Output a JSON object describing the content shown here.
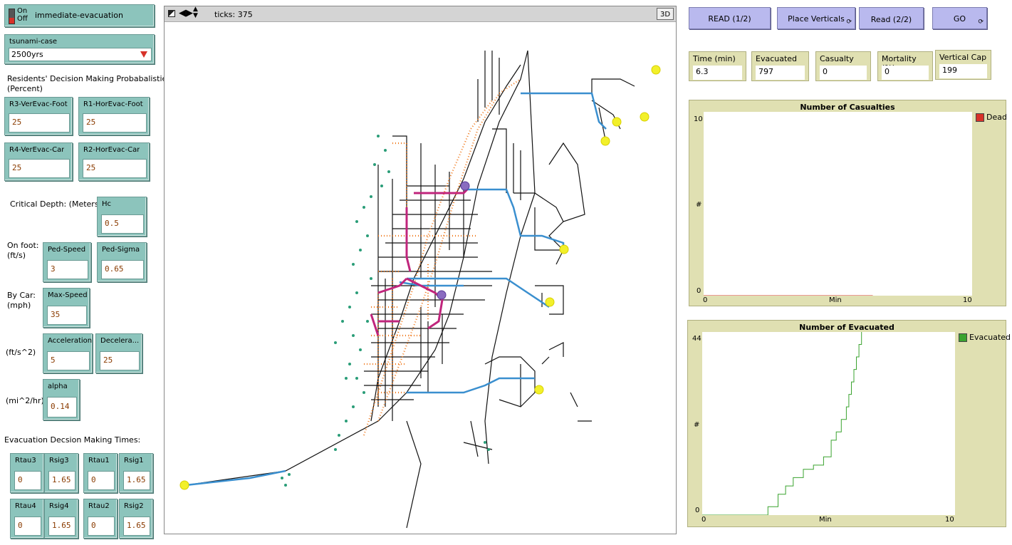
{
  "switch": {
    "on": "On",
    "off": "Off",
    "label": "immediate-evacuation"
  },
  "chooser": {
    "label": "tsunami-case",
    "value": "2500yrs"
  },
  "notes": {
    "decision_title": "Residents' Decision Making Probabalisties :",
    "decision_unit": "(Percent)",
    "critical_depth": "Critical Depth: (Meters)",
    "on_foot": "On foot:",
    "on_foot_unit": "(ft/s)",
    "by_car": "By Car:",
    "by_car_unit": "(mph)",
    "accel_unit": "(ft/s^2)",
    "alpha_unit": "(mi^2/hr)",
    "times_title": "Evacuation Decsion Making Times:"
  },
  "inputs": {
    "r3": {
      "label": "R3-VerEvac-Foot",
      "value": "25"
    },
    "r1": {
      "label": "R1-HorEvac-Foot",
      "value": "25"
    },
    "r4": {
      "label": "R4-VerEvac-Car",
      "value": "25"
    },
    "r2": {
      "label": "R2-HorEvac-Car",
      "value": "25"
    },
    "hc": {
      "label": "Hc",
      "value": "0.5"
    },
    "ped_speed": {
      "label": "Ped-Speed",
      "value": "3"
    },
    "ped_sigma": {
      "label": "Ped-Sigma",
      "value": "0.65"
    },
    "max_speed": {
      "label": "Max-Speed",
      "value": "35"
    },
    "acceleration": {
      "label": "Acceleration",
      "value": "5"
    },
    "deceleration": {
      "label": "Decelera...",
      "value": "25"
    },
    "alpha": {
      "label": "alpha",
      "value": "0.14"
    },
    "rtau3": {
      "label": "Rtau3",
      "value": "0"
    },
    "rsig3": {
      "label": "Rsig3",
      "value": "1.65"
    },
    "rtau1": {
      "label": "Rtau1",
      "value": "0"
    },
    "rsig1": {
      "label": "Rsig1",
      "value": "1.65"
    },
    "rtau4": {
      "label": "Rtau4",
      "value": "0"
    },
    "rsig4": {
      "label": "Rsig4",
      "value": "1.65"
    },
    "rtau2": {
      "label": "Rtau2",
      "value": "0"
    },
    "rsig2": {
      "label": "Rsig2",
      "value": "1.65"
    }
  },
  "view": {
    "ticks": "ticks: 375",
    "three_d": "3D"
  },
  "buttons": {
    "read1": "READ (1/2)",
    "place": "Place Verticals",
    "read2": "Read (2/2)",
    "go": "GO"
  },
  "monitors": {
    "time": {
      "label": "Time (min)",
      "value": "6.3"
    },
    "evacuated": {
      "label": "Evacuated",
      "value": "797"
    },
    "casualty": {
      "label": "Casualty",
      "value": "0"
    },
    "mortality": {
      "label": "Mortality (%)",
      "value": "0"
    },
    "vcap": {
      "label": "Vertical Cap",
      "value": "199"
    }
  },
  "casualties_plot": {
    "title": "Number of Casualties",
    "legend": "Dead",
    "xlabel": "Min",
    "ylabel": "#",
    "xmin": "0",
    "xmax": "10",
    "ymin": "0",
    "ymax": "10",
    "color": "#d73229"
  },
  "evacuated_plot": {
    "title": "Number of Evacuated",
    "legend": "Evacuated",
    "xlabel": "Min",
    "ylabel": "#",
    "xmin": "0",
    "xmax": "10",
    "ymin": "0",
    "ymax": "44",
    "color": "#3aa32f"
  },
  "chart_data": [
    {
      "type": "line",
      "title": "Number of Casualties",
      "xlabel": "Min",
      "ylabel": "#",
      "xlim": [
        0,
        10
      ],
      "ylim": [
        0,
        10
      ],
      "series": [
        {
          "name": "Dead",
          "x": [
            0,
            6.3
          ],
          "y": [
            0,
            0
          ]
        }
      ]
    },
    {
      "type": "line",
      "title": "Number of Evacuated",
      "xlabel": "Min",
      "ylabel": "#",
      "xlim": [
        0,
        10
      ],
      "ylim": [
        0,
        44
      ],
      "series": [
        {
          "name": "Evacuated",
          "x": [
            0,
            2.1,
            2.6,
            3.0,
            3.3,
            3.6,
            4.0,
            4.4,
            4.8,
            5.1,
            5.3,
            5.5,
            5.7,
            5.8,
            5.9,
            6.0,
            6.1,
            6.2,
            6.3
          ],
          "y": [
            0,
            0,
            2,
            5,
            7,
            9,
            11,
            12,
            14,
            18,
            20,
            23,
            26,
            29,
            32,
            35,
            38,
            41,
            44
          ]
        }
      ]
    }
  ]
}
